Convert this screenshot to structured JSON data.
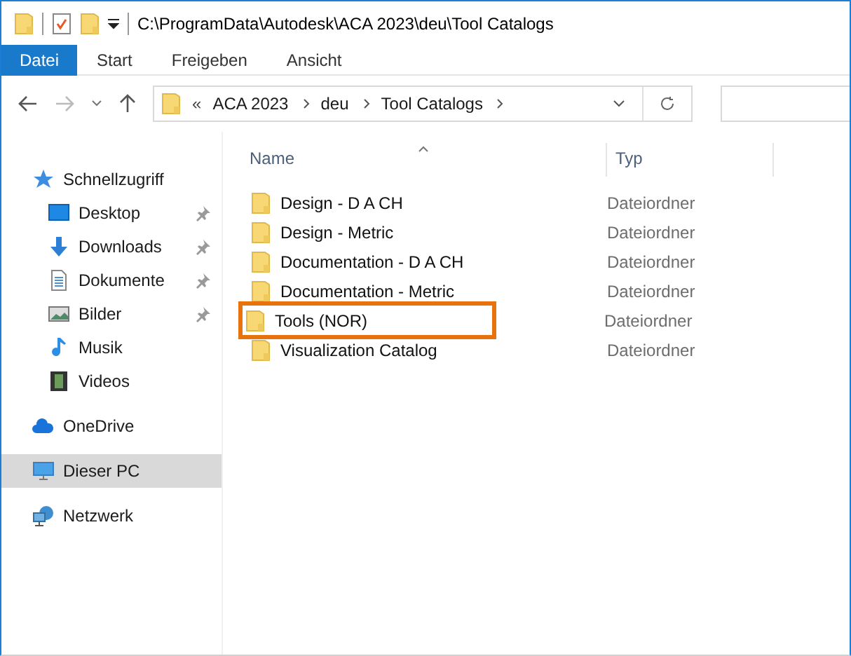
{
  "window": {
    "title": "C:\\ProgramData\\Autodesk\\ACA 2023\\deu\\Tool Catalogs"
  },
  "ribbon_tabs": [
    {
      "label": "Datei",
      "selected": true
    },
    {
      "label": "Start",
      "selected": false
    },
    {
      "label": "Freigeben",
      "selected": false
    },
    {
      "label": "Ansicht",
      "selected": false
    }
  ],
  "address_bar": {
    "overflow": "«",
    "segments": [
      "ACA 2023",
      "deu",
      "Tool Catalogs"
    ]
  },
  "sidebar": {
    "items": [
      {
        "label": "Schnellzugriff",
        "kind": "star",
        "pinned": false,
        "selected": false,
        "children": [
          {
            "label": "Desktop",
            "kind": "desktop",
            "pinned": true,
            "selected": false
          },
          {
            "label": "Downloads",
            "kind": "download",
            "pinned": true,
            "selected": false
          },
          {
            "label": "Dokumente",
            "kind": "document",
            "pinned": true,
            "selected": false
          },
          {
            "label": "Bilder",
            "kind": "pictures",
            "pinned": true,
            "selected": false
          },
          {
            "label": "Musik",
            "kind": "music",
            "pinned": false,
            "selected": false
          },
          {
            "label": "Videos",
            "kind": "video",
            "pinned": false,
            "selected": false
          }
        ]
      },
      {
        "label": "OneDrive",
        "kind": "cloud",
        "pinned": false,
        "selected": false
      },
      {
        "label": "Dieser PC",
        "kind": "pc",
        "pinned": false,
        "selected": true
      },
      {
        "label": "Netzwerk",
        "kind": "network",
        "pinned": false,
        "selected": false
      }
    ]
  },
  "table": {
    "columns": [
      "Name",
      "Typ"
    ],
    "rows": [
      {
        "name": "Design - D A CH",
        "type": "Dateiordner",
        "highlighted": false
      },
      {
        "name": "Design - Metric",
        "type": "Dateiordner",
        "highlighted": false
      },
      {
        "name": "Documentation - D A CH",
        "type": "Dateiordner",
        "highlighted": false
      },
      {
        "name": "Documentation - Metric",
        "type": "Dateiordner",
        "highlighted": false
      },
      {
        "name": "Tools (NOR)",
        "type": "Dateiordner",
        "highlighted": true
      },
      {
        "name": "Visualization Catalog",
        "type": "Dateiordner",
        "highlighted": false
      }
    ]
  }
}
